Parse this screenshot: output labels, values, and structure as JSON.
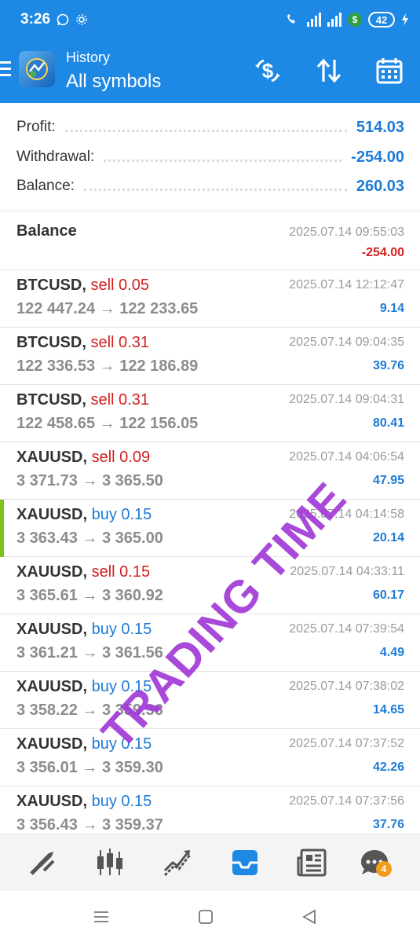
{
  "status_bar": {
    "time": "3:26",
    "battery": "42"
  },
  "toolbar": {
    "title": "History",
    "subtitle": "All symbols"
  },
  "summary": {
    "profit_label": "Profit:",
    "profit_value": "514.03",
    "withdrawal_label": "Withdrawal:",
    "withdrawal_value": "-254.00",
    "balance_label": "Balance:",
    "balance_value": "260.03"
  },
  "balance_entry": {
    "label": "Balance",
    "time": "2025.07.14 09:55:03",
    "amount": "-254.00"
  },
  "deals": [
    {
      "symbol": "BTCUSD,",
      "type": "sell 0.05",
      "prices": "122 447.24 → 122 233.65",
      "time": "2025.07.14 12:12:47",
      "profit": "9.14",
      "side": "sell"
    },
    {
      "symbol": "BTCUSD,",
      "type": "sell 0.31",
      "prices": "122 336.53 → 122 186.89",
      "time": "2025.07.14 09:04:35",
      "profit": "39.76",
      "side": "sell"
    },
    {
      "symbol": "BTCUSD,",
      "type": "sell 0.31",
      "prices": "122 458.65 → 122 156.05",
      "time": "2025.07.14 09:04:31",
      "profit": "80.41",
      "side": "sell"
    },
    {
      "symbol": "XAUUSD,",
      "type": "sell 0.09",
      "prices": "3 371.73 → 3 365.50",
      "time": "2025.07.14 04:06:54",
      "profit": "47.95",
      "side": "sell"
    },
    {
      "symbol": "XAUUSD,",
      "type": "buy 0.15",
      "prices": "3 363.43 → 3 365.00",
      "time": "2025.07.14 04:14:58",
      "profit": "20.14",
      "side": "buy"
    },
    {
      "symbol": "XAUUSD,",
      "type": "sell 0.15",
      "prices": "3 365.61 → 3 360.92",
      "time": "2025.07.14 04:33:11",
      "profit": "60.17",
      "side": "sell"
    },
    {
      "symbol": "XAUUSD,",
      "type": "buy 0.15",
      "prices": "3 361.21 → 3 361.56",
      "time": "2025.07.14 07:39:54",
      "profit": "4.49",
      "side": "buy"
    },
    {
      "symbol": "XAUUSD,",
      "type": "buy 0.15",
      "prices": "3 358.22 → 3 359.36",
      "time": "2025.07.14 07:38:02",
      "profit": "14.65",
      "side": "buy"
    },
    {
      "symbol": "XAUUSD,",
      "type": "buy 0.15",
      "prices": "3 356.01 → 3 359.30",
      "time": "2025.07.14 07:37:52",
      "profit": "42.26",
      "side": "buy"
    },
    {
      "symbol": "XAUUSD,",
      "type": "buy 0.15",
      "prices": "3 356.43 → 3 359.37",
      "time": "2025.07.14 07:37:56",
      "profit": "37.76",
      "side": "buy"
    }
  ],
  "bottom_nav": {
    "chat_badge": "4"
  },
  "watermark": "TRADING TIME",
  "colors": {
    "accent": "#1e88e5",
    "sell": "#d32020",
    "buy": "#1e7bd4",
    "watermark": "#a23ad6",
    "selected_marker": "#7cc21b"
  },
  "icons": {
    "toolbar": [
      "dollar-exchange-icon",
      "sort-icon",
      "calendar-icon"
    ],
    "bottom_nav": [
      "quotes-icon",
      "chart-icon",
      "trade-icon",
      "history-icon",
      "news-icon",
      "chat-icon"
    ],
    "system_nav": [
      "recents-icon",
      "home-icon",
      "back-icon"
    ]
  }
}
